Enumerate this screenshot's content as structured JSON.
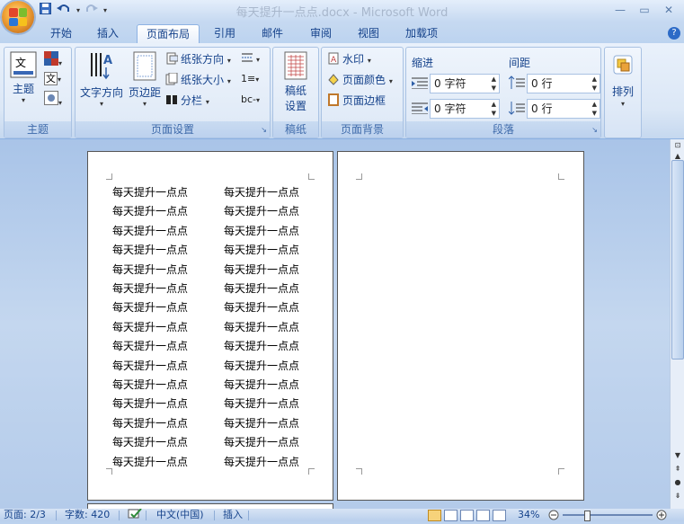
{
  "window": {
    "title": "每天提升一点点.docx - Microsoft Word",
    "minimize": "—",
    "restore": "▭",
    "close": "✕"
  },
  "qat": {
    "save": "save-icon",
    "undo": "undo-icon",
    "redo": "redo-icon",
    "customize": "▾"
  },
  "tabs": [
    "开始",
    "插入",
    "页面布局",
    "引用",
    "邮件",
    "审阅",
    "视图",
    "加载项"
  ],
  "active_tab": "页面布局",
  "ribbon": {
    "theme_group": {
      "label": "主题",
      "themes_button": "主题"
    },
    "page_setup": {
      "label": "页面设置",
      "text_direction": "文字方向",
      "margins": "页边距",
      "orientation": "纸张方向",
      "size": "纸张大小",
      "columns": "分栏",
      "breaks_hyphen": "bc-"
    },
    "draft": {
      "label": "稿纸",
      "button_line1": "稿纸",
      "button_line2": "设置"
    },
    "page_background": {
      "label": "页面背景",
      "watermark": "水印",
      "page_color": "页面颜色",
      "page_border": "页面边框"
    },
    "paragraph": {
      "label": "段落",
      "indent_title": "缩进",
      "spacing_title": "间距",
      "indent_left": "0 字符",
      "indent_right": "0 字符",
      "spacing_before": "0 行",
      "spacing_after": "0 行"
    },
    "arrange": {
      "label": "排列"
    }
  },
  "document": {
    "line_text": "每天提升一点点",
    "col2_text": "每天提升一点点",
    "rows": 15
  },
  "status": {
    "page": "页面: 2/3",
    "words": "字数: 420",
    "language": "中文(中国)",
    "mode": "插入",
    "zoom": "34%"
  }
}
